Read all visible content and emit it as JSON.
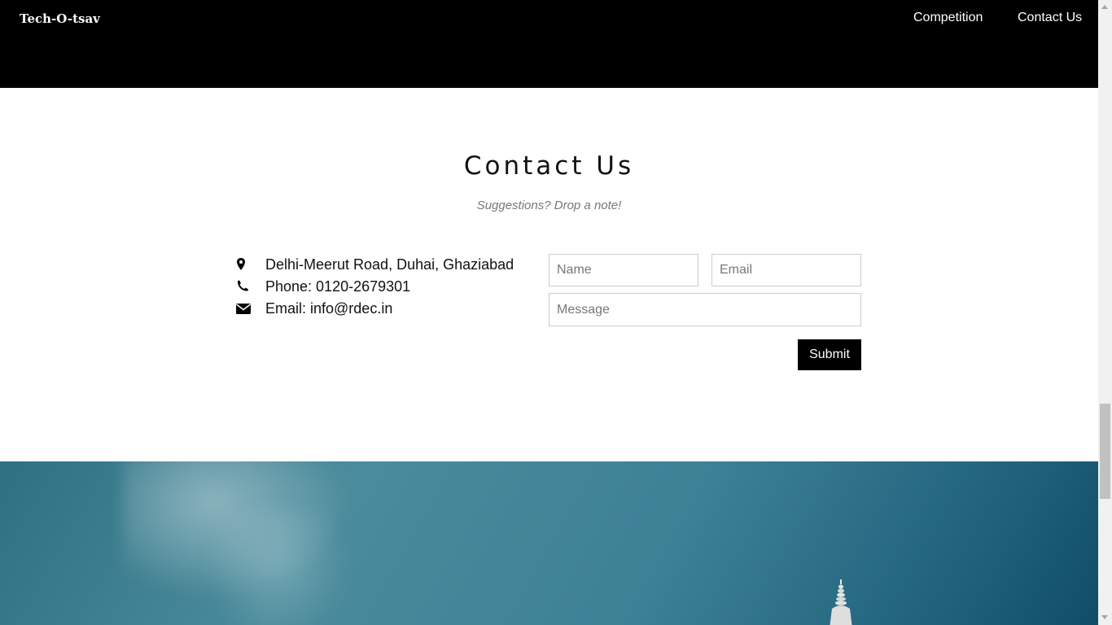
{
  "navbar": {
    "brand": "Tech-O-tsav",
    "links": [
      {
        "label": "Competition"
      },
      {
        "label": "Contact Us"
      }
    ]
  },
  "contact": {
    "title": "Contact Us",
    "subtitle": "Suggestions? Drop a note!",
    "info": [
      {
        "icon": "map-marker-icon",
        "text": "Delhi-Meerut Road, Duhai, Ghaziabad"
      },
      {
        "icon": "phone-icon",
        "text": "Phone: 0120-2679301"
      },
      {
        "icon": "envelope-icon",
        "text": "Email: info@rdec.in"
      }
    ],
    "form": {
      "name_placeholder": "Name",
      "email_placeholder": "Email",
      "message_placeholder": "Message",
      "submit_label": "Submit"
    }
  },
  "colors": {
    "navbar_bg": "#000000",
    "button_bg": "#000000",
    "hero_sky": "#3d8196"
  }
}
